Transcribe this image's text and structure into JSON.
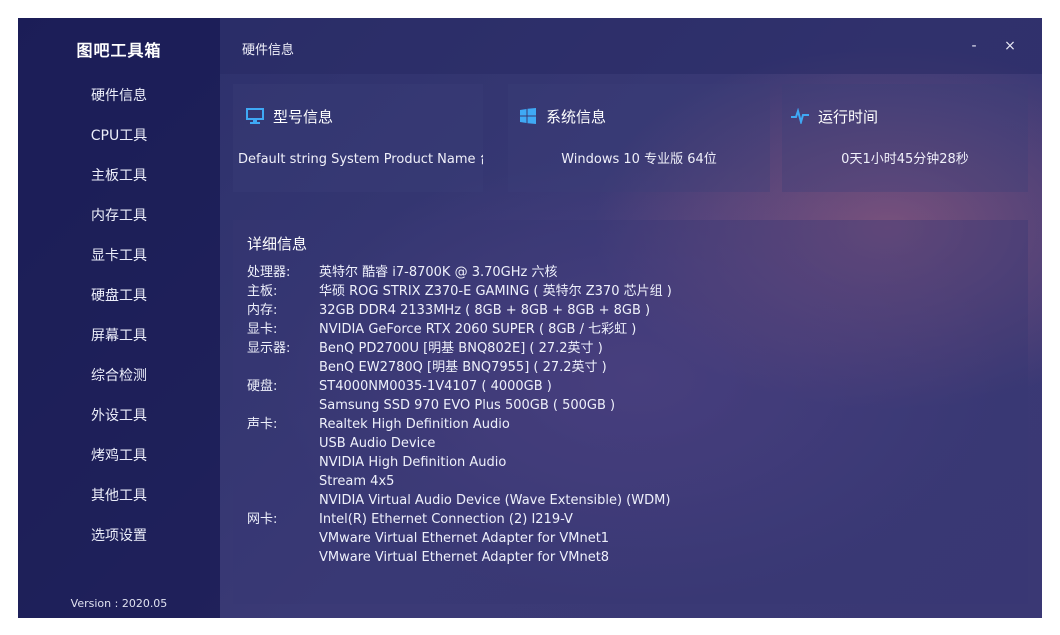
{
  "app": {
    "title": "图吧工具箱",
    "version": "Version : 2020.05"
  },
  "sidebar": {
    "items": [
      {
        "label": "硬件信息"
      },
      {
        "label": "CPU工具"
      },
      {
        "label": "主板工具"
      },
      {
        "label": "内存工具"
      },
      {
        "label": "显卡工具"
      },
      {
        "label": "硬盘工具"
      },
      {
        "label": "屏幕工具"
      },
      {
        "label": "综合检测"
      },
      {
        "label": "外设工具"
      },
      {
        "label": "烤鸡工具"
      },
      {
        "label": "其他工具"
      },
      {
        "label": "选项设置"
      }
    ]
  },
  "titlebar": {
    "title": "硬件信息",
    "minimize": "-",
    "close": "×"
  },
  "cards": {
    "model": {
      "title": "型号信息",
      "icon": "monitor-icon",
      "value": "Default string System Product Name 台"
    },
    "system": {
      "title": "系统信息",
      "icon": "windows-icon",
      "value": "Windows 10 专业版 64位"
    },
    "uptime": {
      "title": "运行时间",
      "icon": "pulse-icon",
      "value": "0天1小时45分钟28秒"
    }
  },
  "detail": {
    "title": "详细信息",
    "rows": [
      {
        "label": "处理器:",
        "value": "英特尔 酷睿 i7-8700K @ 3.70GHz 六核"
      },
      {
        "label": "主板:",
        "value": "华硕 ROG STRIX Z370-E GAMING ( 英特尔 Z370 芯片组 )"
      },
      {
        "label": "内存:",
        "value": "32GB DDR4 2133MHz ( 8GB + 8GB + 8GB + 8GB )"
      },
      {
        "label": "显卡:",
        "value": "NVIDIA GeForce RTX 2060 SUPER ( 8GB / 七彩虹 )"
      },
      {
        "label": "显示器:",
        "value": "BenQ PD2700U [明基 BNQ802E] ( 27.2英寸 )"
      },
      {
        "label": "",
        "value": "BenQ EW2780Q [明基 BNQ7955] ( 27.2英寸 )"
      },
      {
        "label": "硬盘:",
        "value": "ST4000NM0035-1V4107 ( 4000GB )"
      },
      {
        "label": "",
        "value": "Samsung SSD 970 EVO Plus 500GB ( 500GB )"
      },
      {
        "label": "声卡:",
        "value": "Realtek High Definition Audio"
      },
      {
        "label": "",
        "value": "USB Audio Device"
      },
      {
        "label": "",
        "value": "NVIDIA High Definition Audio"
      },
      {
        "label": "",
        "value": "Stream 4x5"
      },
      {
        "label": "",
        "value": "NVIDIA Virtual Audio Device (Wave Extensible) (WDM)"
      },
      {
        "label": "网卡:",
        "value": "Intel(R) Ethernet Connection (2) I219-V"
      },
      {
        "label": "",
        "value": "VMware Virtual Ethernet Adapter for VMnet1"
      },
      {
        "label": "",
        "value": "VMware Virtual Ethernet Adapter for VMnet8"
      }
    ]
  },
  "colors": {
    "accent": "#3fa9f5",
    "sidebar": "#16185a",
    "background": "#343671"
  }
}
